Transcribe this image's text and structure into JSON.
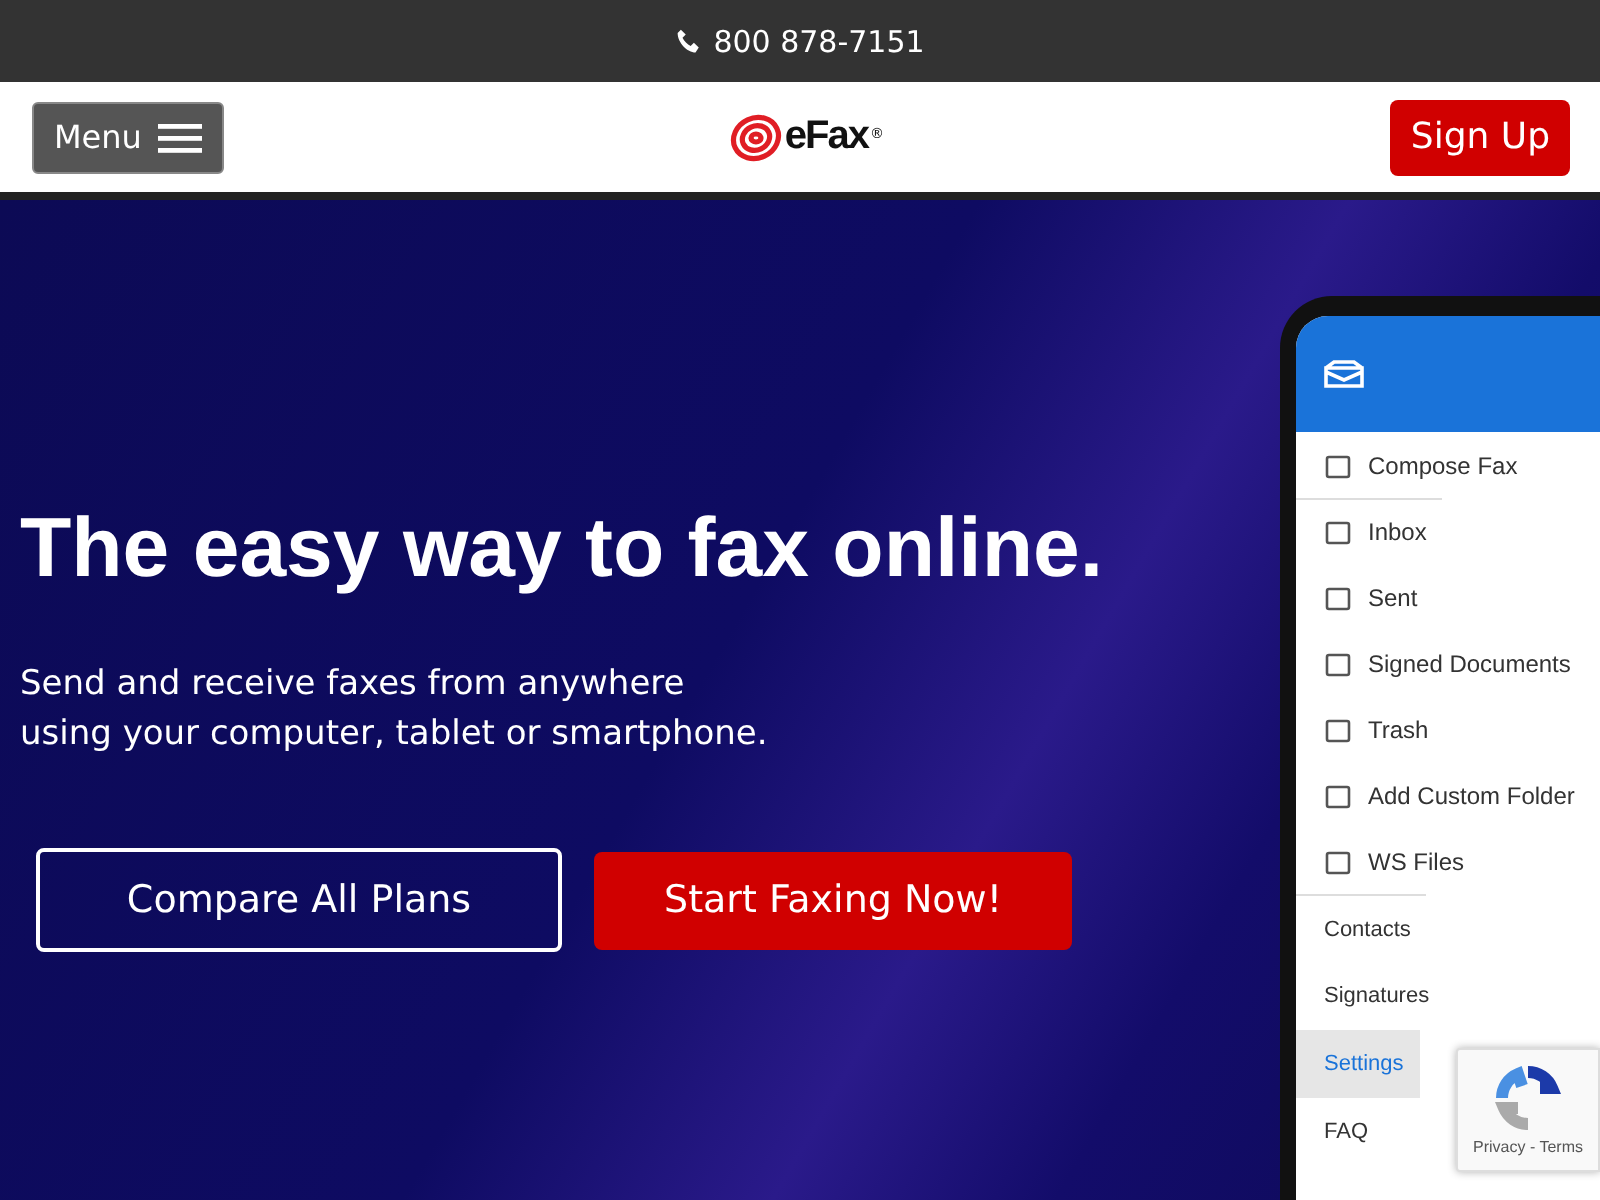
{
  "top_bar": {
    "phone": "800 878-7151"
  },
  "header": {
    "menu_button": "Menu",
    "logo": {
      "text": "eFax",
      "mark": "®"
    },
    "signup_button": "Sign Up"
  },
  "hero": {
    "headline": "The easy way to fax online.",
    "subtitle": [
      "Send and receive faxes from anywhere",
      "using your computer, tablet or smartphone."
    ],
    "buttons": [
      {
        "label": "Compare All Plans",
        "kind": "outline"
      },
      {
        "label": "Start Faxing Now!",
        "kind": "solid"
      }
    ],
    "phone_menu": [
      {
        "label": "Compose Fax",
        "kind": "main",
        "selected": false
      },
      {
        "label": "Inbox",
        "kind": "main",
        "selected": false
      },
      {
        "label": "Sent",
        "kind": "main",
        "selected": false
      },
      {
        "label": "Signed Documents",
        "kind": "main",
        "selected": false
      },
      {
        "label": "Trash",
        "kind": "main",
        "selected": false
      },
      {
        "label": "Add Custom Folder",
        "kind": "main",
        "selected": false
      },
      {
        "label": "WS Files",
        "kind": "main",
        "selected": false
      },
      {
        "label": "Contacts",
        "kind": "plain",
        "selected": false
      },
      {
        "label": "Signatures",
        "kind": "plain",
        "selected": false
      },
      {
        "label": "Settings",
        "kind": "plain",
        "selected": true
      },
      {
        "label": "FAQ",
        "kind": "plain",
        "selected": false
      }
    ]
  },
  "recaptcha": {
    "links": "Privacy - Terms"
  }
}
